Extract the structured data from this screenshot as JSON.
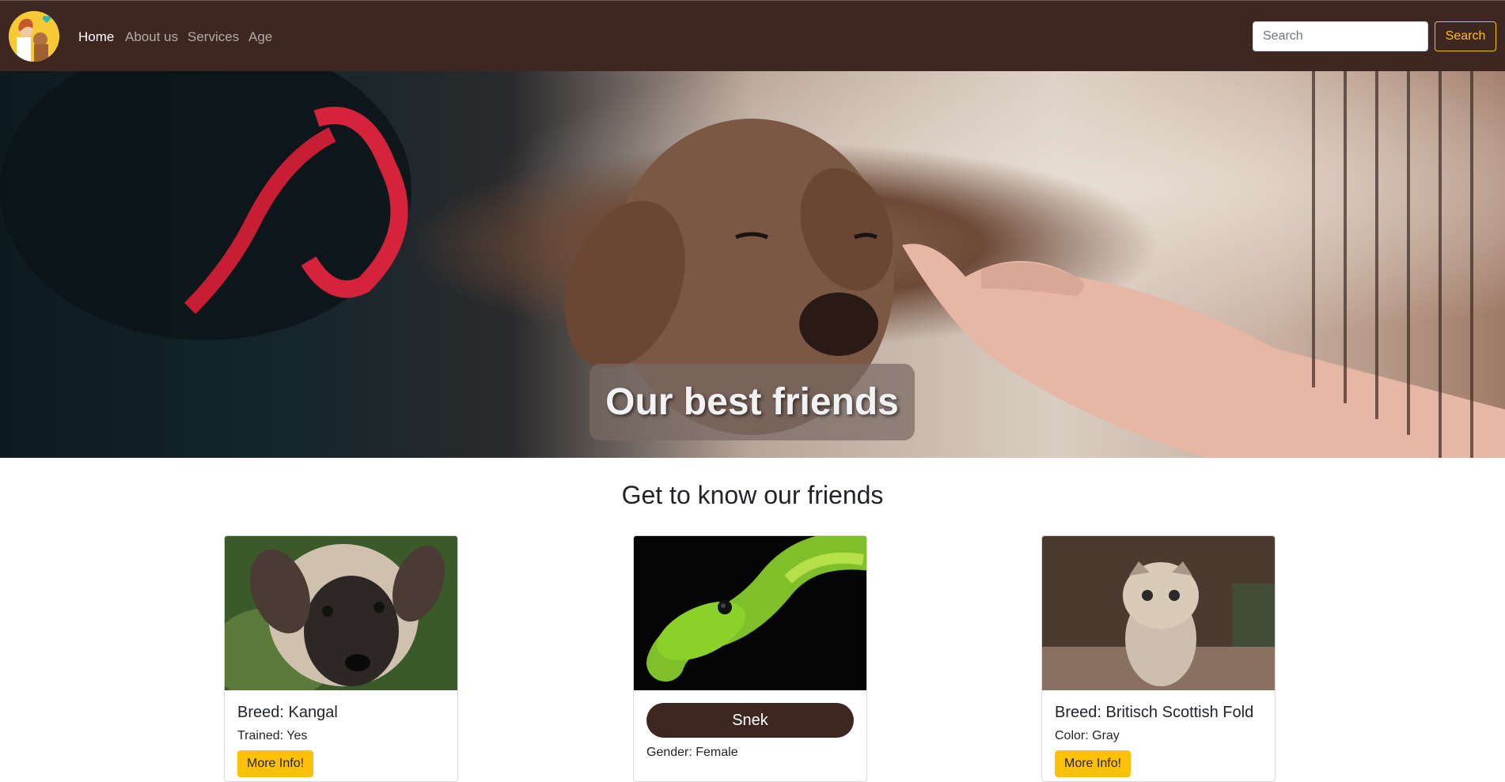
{
  "nav": {
    "logo_icon": "pets-logo-icon",
    "links": [
      {
        "label": "Home",
        "active": true
      },
      {
        "label": "About us",
        "active": false
      },
      {
        "label": "Services",
        "active": false
      },
      {
        "label": "Age",
        "active": false
      }
    ],
    "search": {
      "placeholder": "Search",
      "value": "",
      "button_label": "Search"
    }
  },
  "hero": {
    "caption": "Our best friends"
  },
  "section": {
    "title": "Get to know our friends"
  },
  "cards": [
    {
      "image_icon": "puppy-photo",
      "title": "Breed: Kangal",
      "detail": "Trained: Yes",
      "button_label": "More Info!"
    },
    {
      "image_icon": "green-snake-photo",
      "title": "Snek",
      "detail": "Gender: Female"
    },
    {
      "image_icon": "kitten-photo",
      "title": "Breed: Britisch Scottish Fold",
      "detail": "Color: Gray",
      "button_label": "More Info!"
    }
  ],
  "colors": {
    "navbar": "#3e2720",
    "accent": "#ffc107",
    "pill": "#3e2720"
  }
}
